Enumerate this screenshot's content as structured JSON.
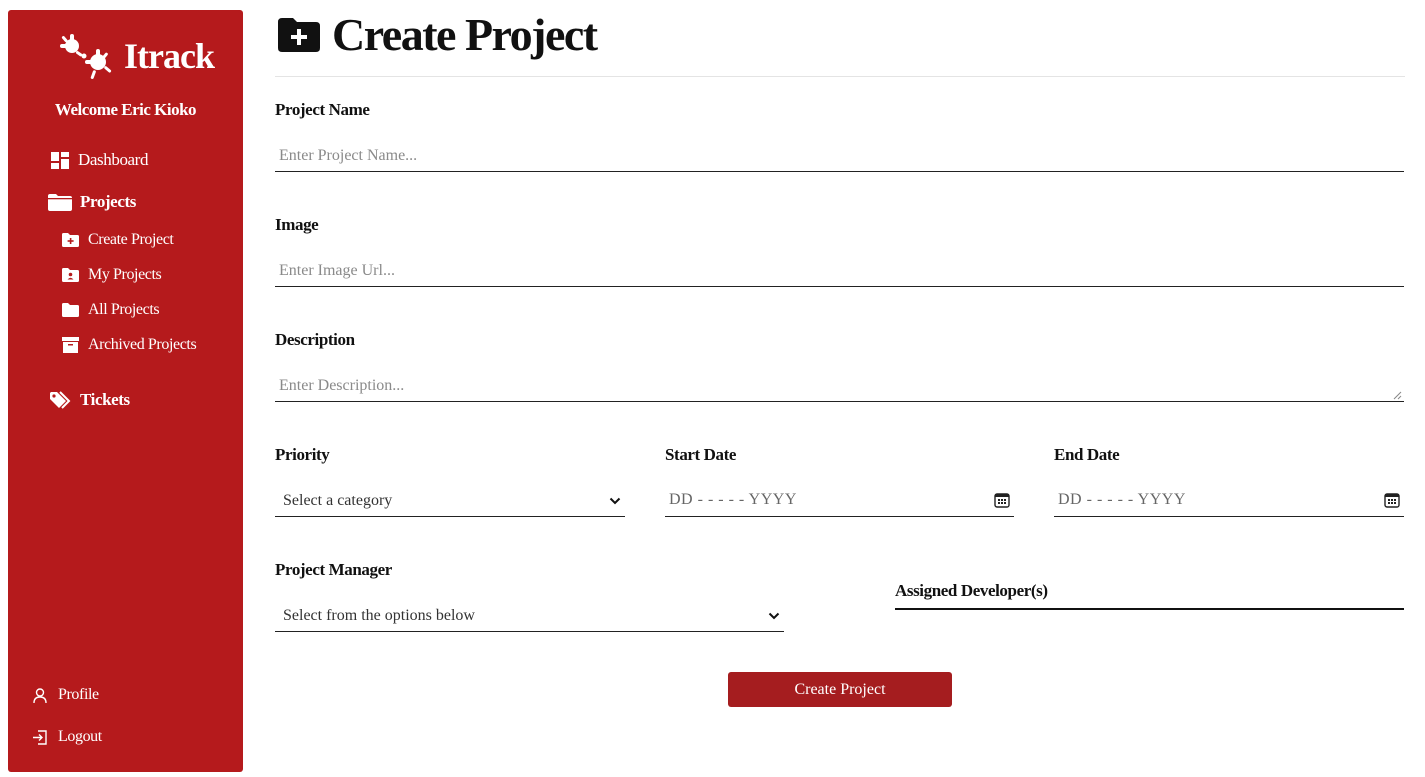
{
  "sidebar": {
    "logo_text": "Itrack",
    "welcome": "Welcome Eric Kioko",
    "items": [
      {
        "label": "Dashboard",
        "icon": "dashboard-icon"
      },
      {
        "label": "Projects",
        "icon": "folder-icon"
      },
      {
        "label": "Create Project",
        "icon": "folder-plus-icon"
      },
      {
        "label": "My Projects",
        "icon": "folder-user-icon"
      },
      {
        "label": "All Projects",
        "icon": "folder-icon"
      },
      {
        "label": "Archived Projects",
        "icon": "archive-icon"
      },
      {
        "label": "Tickets",
        "icon": "tags-icon"
      }
    ],
    "profile_label": "Profile",
    "logout_label": "Logout",
    "bg_color": "#b51a1c"
  },
  "page": {
    "title": "Create Project",
    "title_icon": "folder-plus-icon"
  },
  "form": {
    "project_name": {
      "label": "Project Name",
      "placeholder": "Enter Project Name..."
    },
    "image": {
      "label": "Image",
      "placeholder": "Enter Image Url..."
    },
    "description": {
      "label": "Description",
      "placeholder": "Enter Description..."
    },
    "priority": {
      "label": "Priority",
      "value": "Select a category"
    },
    "start_date": {
      "label": "Start Date",
      "value": "DD - - - - - YYYY"
    },
    "end_date": {
      "label": "End Date",
      "value": "DD - - - - - YYYY"
    },
    "project_manager": {
      "label": "Project Manager",
      "value": "Select from the options below"
    },
    "assigned_developers": {
      "label": "Assigned Developer(s)"
    },
    "submit_label": "Create Project",
    "button_color": "#a51d1f"
  }
}
